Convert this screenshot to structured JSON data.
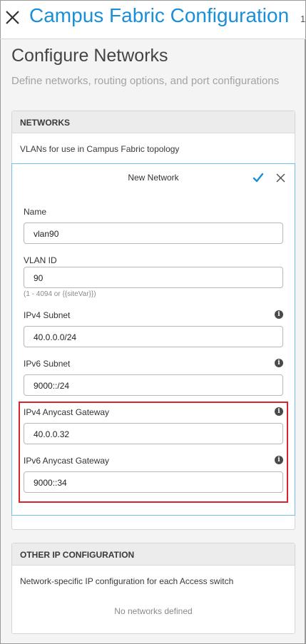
{
  "header": {
    "title": "Campus Fabric Configuration",
    "title_overflow": "1",
    "close_icon": "close-icon"
  },
  "page": {
    "heading": "Configure Networks",
    "subheading": "Define networks, routing options, and port configurations"
  },
  "networks": {
    "header": "NETWORKS",
    "description": "VLANs for use in Campus Fabric topology",
    "new_network": {
      "title": "New Network",
      "confirm_icon": "check-icon",
      "cancel_icon": "close-icon",
      "fields": {
        "name": {
          "label": "Name",
          "value": "vlan90"
        },
        "vlan_id": {
          "label": "VLAN ID",
          "value": "90",
          "hint": "(1 - 4094 or {{siteVar}})"
        },
        "ipv4_subnet": {
          "label": "IPv4 Subnet",
          "value": "40.0.0.0/24"
        },
        "ipv6_subnet": {
          "label": "IPv6 Subnet",
          "value": "9000::/24"
        },
        "ipv4_anycast": {
          "label": "IPv4 Anycast Gateway",
          "value": "40.0.0.32"
        },
        "ipv6_anycast": {
          "label": "IPv6 Anycast Gateway",
          "value": "9000::34"
        }
      },
      "info_glyph": "i"
    }
  },
  "other_ip": {
    "header": "OTHER IP CONFIGURATION",
    "description": "Network-specific IP configuration for each Access switch",
    "empty_text": "No networks defined"
  },
  "colors": {
    "accent": "#1a8fd9",
    "highlight": "#d9232d",
    "form_border": "#6ec0ea"
  }
}
